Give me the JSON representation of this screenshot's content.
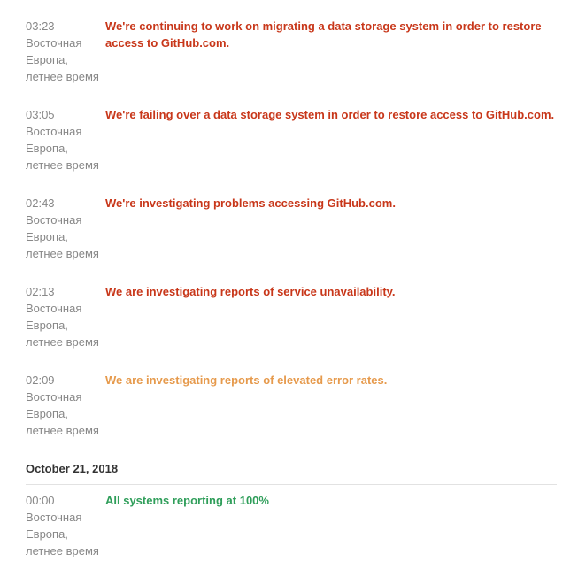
{
  "entries": [
    {
      "time": "03:23",
      "tz": "Восточная Европа, летнее время",
      "message": "We're continuing to work on migrating a data storage system in order to restore access to GitHub.com.",
      "severity": "major"
    },
    {
      "time": "03:05",
      "tz": "Восточная Европа, летнее время",
      "message": "We're failing over a data storage system in order to restore access to GitHub.com.",
      "severity": "major"
    },
    {
      "time": "02:43",
      "tz": "Восточная Европа, летнее время",
      "message": "We're investigating problems accessing GitHub.com.",
      "severity": "major"
    },
    {
      "time": "02:13",
      "tz": "Восточная Европа, летнее время",
      "message": "We are investigating reports of service unavailability.",
      "severity": "major"
    },
    {
      "time": "02:09",
      "tz": "Восточная Европа, летнее время",
      "message": "We are investigating reports of elevated error rates.",
      "severity": "minor"
    }
  ],
  "date_heading": "October 21, 2018",
  "entries_after": [
    {
      "time": "00:00",
      "tz": "Восточная Европа, летнее время",
      "message": "All systems reporting at 100%",
      "severity": "good"
    }
  ],
  "colors": {
    "major": "#c8371a",
    "minor": "#e69a4c",
    "good": "#2f9e5a",
    "time_text": "#888888"
  }
}
